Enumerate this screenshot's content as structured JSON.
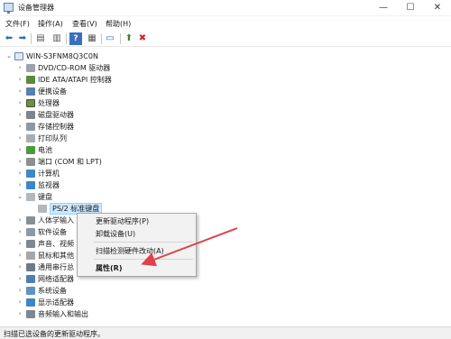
{
  "window": {
    "title": "设备管理器",
    "minimize_glyph": "—",
    "maximize_glyph": "☐",
    "close_glyph": "✕"
  },
  "menu": [
    "文件(F)",
    "操作(A)",
    "查看(V)",
    "帮助(H)"
  ],
  "toolbar_icons": [
    "back-arrow-icon",
    "forward-arrow-icon",
    "properties-icon",
    "show-hide-icon",
    "help-icon",
    "grid-view-icon",
    "monitor-icon",
    "update-driver-icon",
    "uninstall-icon"
  ],
  "toolbar_glyphs": {
    "back": "⬅",
    "forward": "➡",
    "properties": "▤",
    "showhide": "▥",
    "help": "?",
    "grid": "▦",
    "monitor": "▭",
    "update": "⬆",
    "uninstall": "✖"
  },
  "colors": {
    "help": "#3a6fbf",
    "update": "#2e8b2e",
    "uninstall": "#d0232a",
    "arrow": "#e0414b"
  },
  "tree": {
    "root": "WIN-S3FNM8Q3C0N",
    "categories": [
      "DVD/CD-ROM 驱动器",
      "IDE ATA/ATAPI 控制器",
      "便携设备",
      "处理器",
      "磁盘驱动器",
      "存储控制器",
      "打印队列",
      "电池",
      "端口 (COM 和 LPT)",
      "计算机",
      "监视器",
      "键盘"
    ],
    "keyboard_child": "PS/2 标准键盘",
    "after_categories": [
      "人体学输入",
      "软件设备",
      "声音、视频",
      "鼠标和其他",
      "通用串行总",
      "网络适配器",
      "系统设备",
      "显示适配器",
      "音频输入和输出"
    ]
  },
  "context_menu": {
    "update_driver": "更新驱动程序(P)",
    "uninstall_device": "卸载设备(U)",
    "scan_hardware": "扫描检测硬件改动(A)",
    "properties": "属性(R)"
  },
  "status": "扫描已选设备的更新驱动程序。"
}
